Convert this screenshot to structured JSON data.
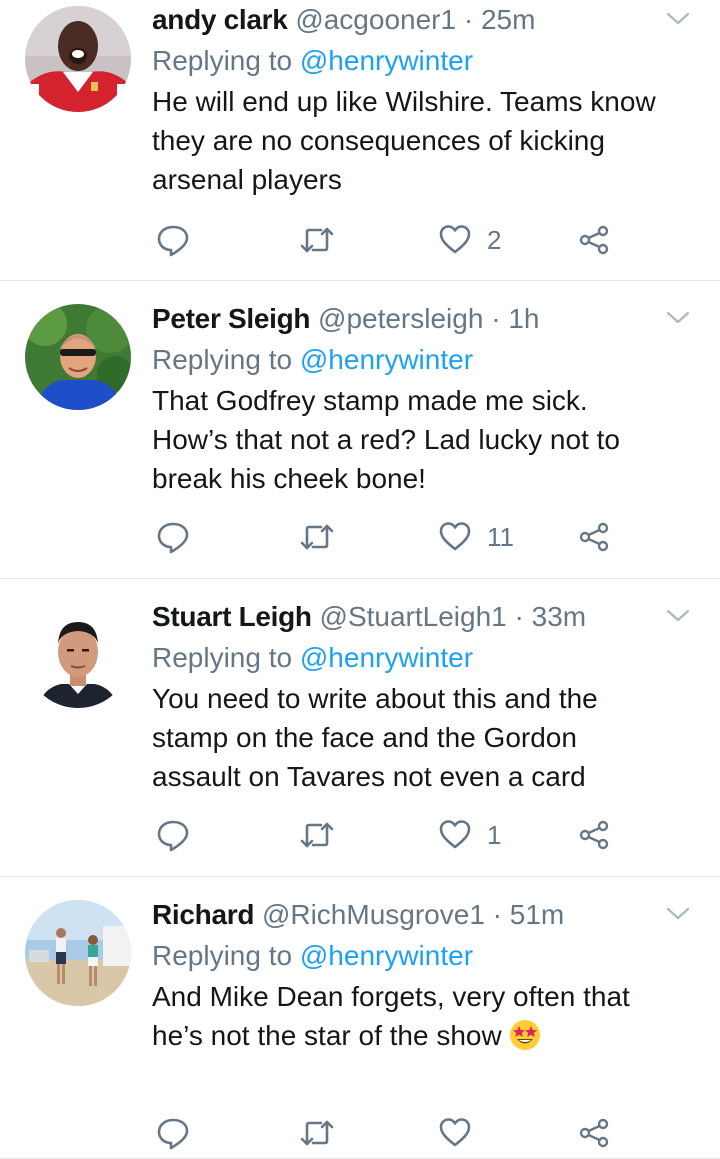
{
  "colors": {
    "text": "#14171a",
    "muted": "#657786",
    "link": "#1da1f2",
    "divider": "#e1e4e6"
  },
  "tweets": [
    {
      "name": "andy clark",
      "handle": "@acgooner1",
      "separator": "·",
      "time": "25m",
      "reply_prefix": "Replying to",
      "reply_to": "@henrywinter",
      "text": "He will end up like Wilshire.  Teams know\nthey are no consequences of kicking\narsenal players",
      "likes": "2",
      "emoji": ""
    },
    {
      "name": "Peter Sleigh",
      "handle": "@petersleigh",
      "separator": "·",
      "time": "1h",
      "reply_prefix": "Replying to",
      "reply_to": "@henrywinter",
      "text": "That Godfrey stamp made me sick.\nHow’s that not a red? Lad lucky not to\nbreak his cheek bone!",
      "likes": "11",
      "emoji": ""
    },
    {
      "name": "Stuart Leigh",
      "handle": "@StuartLeigh1",
      "separator": "·",
      "time": "33m",
      "reply_prefix": "Replying to",
      "reply_to": "@henrywinter",
      "text": "You need to write about this and the\nstamp on the face and the Gordon\nassault on Tavares not even a card",
      "likes": "1",
      "emoji": ""
    },
    {
      "name": "Richard",
      "handle": "@RichMusgrove1",
      "separator": "·",
      "time": "51m",
      "reply_prefix": "Replying to",
      "reply_to": "@henrywinter",
      "text": "And Mike Dean forgets, very often that\nhe’s not the star of the show ",
      "likes": "",
      "emoji": "star-struck-emoji"
    }
  ],
  "icons": {
    "reply": "reply-icon",
    "retweet": "retweet-icon",
    "like": "heart-icon",
    "share": "share-icon",
    "menu": "chevron-down-icon"
  }
}
